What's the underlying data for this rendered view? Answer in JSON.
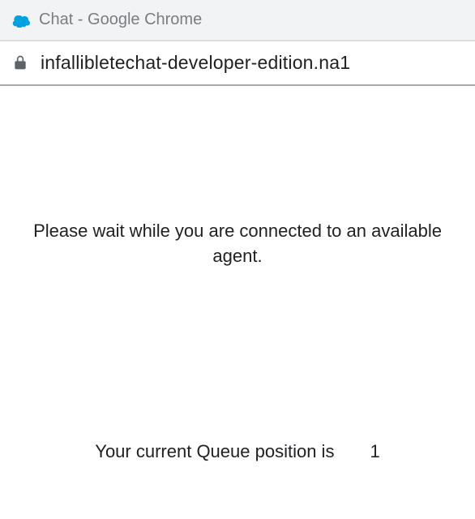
{
  "window": {
    "title": "Chat - Google Chrome",
    "icon": "salesforce-cloud-icon",
    "icon_color": "#00A1E0"
  },
  "address": {
    "url": "infallibletechat-developer-edition.na1",
    "secure": true
  },
  "main": {
    "wait_message": "Please wait while you are connected to an available agent.",
    "queue_label": "Your current Queue position is",
    "queue_position": "1"
  }
}
